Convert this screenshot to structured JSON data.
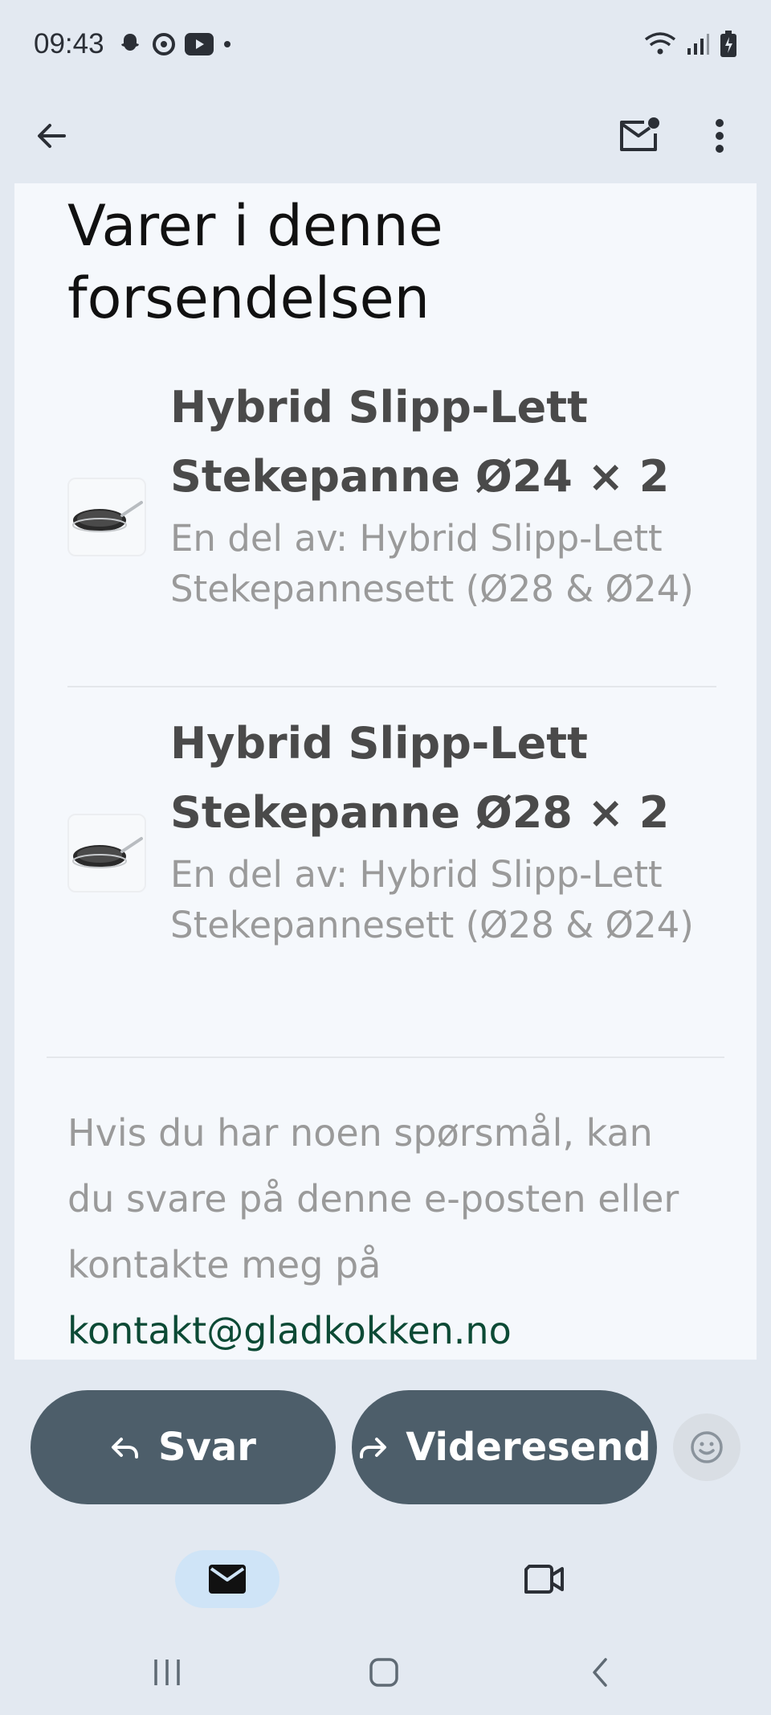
{
  "status_bar": {
    "time": "09:43"
  },
  "app_bar": {
    "back_icon": "arrow-left-icon",
    "mark_unread_icon": "mail-unread-icon",
    "more_icon": "more-vertical-icon"
  },
  "email": {
    "heading": "Varer i denne forsendelsen",
    "items": [
      {
        "title": "Hybrid Slipp-Lett Stekepanne Ø24 × 2",
        "subtitle": "En del av: Hybrid Slipp-Lett Stekepannesett (Ø28 & Ø24)"
      },
      {
        "title": "Hybrid Slipp-Lett Stekepanne Ø28 × 2",
        "subtitle": "En del av: Hybrid Slipp-Lett Stekepannesett (Ø28 & Ø24)"
      }
    ],
    "footer_text": "Hvis du har noen spørsmål, kan du svare på denne e-posten eller kontakte meg på",
    "footer_link": "kontakt@gladkokken.no"
  },
  "actions": {
    "reply_label": "Svar",
    "forward_label": "Videresend"
  },
  "colors": {
    "background": "#e3e9f1",
    "card": "#f5f8fc",
    "pill": "#4d5e6a",
    "link": "#0c4a35",
    "nav_active": "#cfe4f7"
  }
}
